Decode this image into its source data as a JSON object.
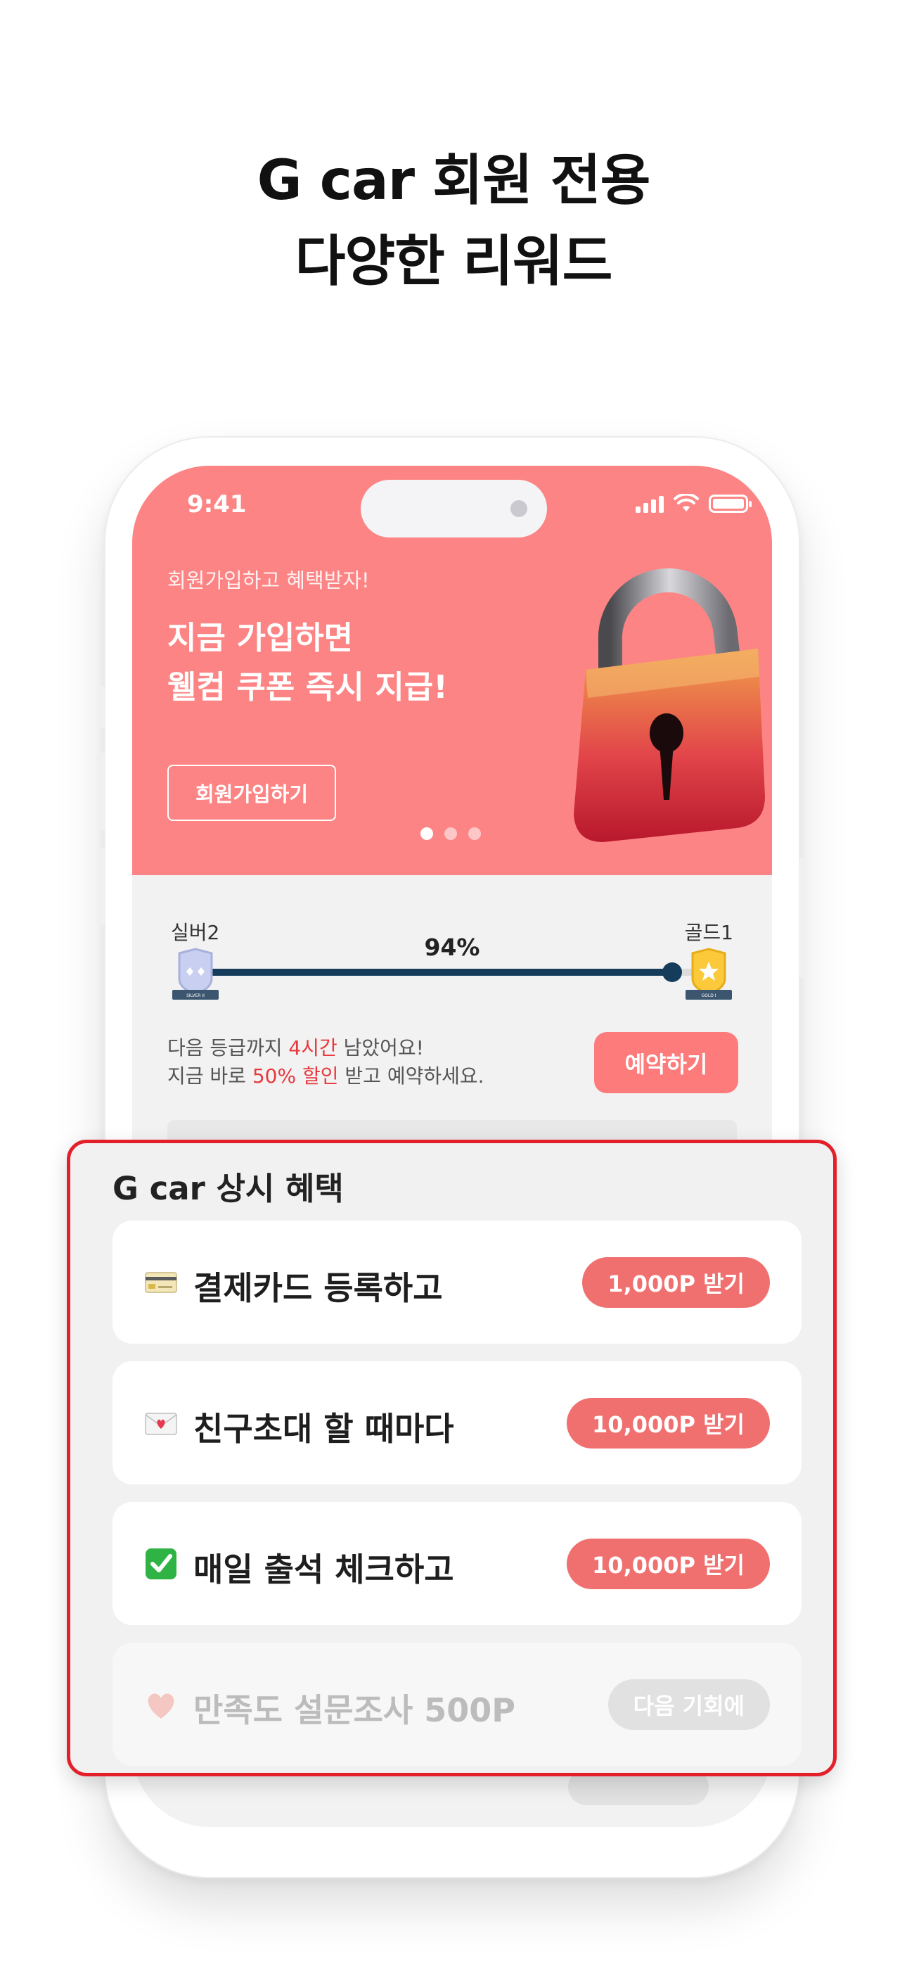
{
  "headline": {
    "line1": "G car 회원 전용",
    "line2": "다양한 리워드"
  },
  "status_bar": {
    "time": "9:41"
  },
  "banner": {
    "subtitle": "회원가입하고 혜택받자!",
    "title_line1": "지금 가입하면",
    "title_line2": "웰컴 쿠폰 즉시 지급!",
    "join_button": "회원가입하기",
    "carousel_pages": 3,
    "carousel_active": 1
  },
  "grade": {
    "current": "실버2",
    "next": "골드1",
    "progress_label": "94%",
    "progress": 0.94,
    "silver_badge_text": "SILVER II",
    "gold_badge_text": "GOLD I"
  },
  "next_grade_info": {
    "line1_pre": "다음 등급까지 ",
    "line1_highlight": "4시간",
    "line1_post": " 남았어요!",
    "line2_pre": "지금 바로 ",
    "line2_highlight": "50% 할인",
    "line2_post": " 받고 예약하세요.",
    "book_button": "예약하기"
  },
  "benefits": {
    "title": "G car 상시 혜택",
    "items": [
      {
        "icon": "credit-card-icon",
        "label": "결제카드 등록하고",
        "action": "1,000P 받기",
        "active": true
      },
      {
        "icon": "love-letter-icon",
        "label": "친구초대 할 때마다",
        "action": "10,000P 받기",
        "active": true
      },
      {
        "icon": "check-mark-icon",
        "label": "매일 출석 체크하고",
        "action": "10,000P 받기",
        "active": true
      },
      {
        "icon": "heart-icon",
        "label": "만족도 설문조사 500P",
        "action": "다음 기회에",
        "active": false
      }
    ]
  },
  "colors": {
    "banner": "#fd8484",
    "accent_red": "#e8393e",
    "progress": "#163c5c",
    "pill": "#f07070",
    "highlight_border": "#e3202a"
  }
}
